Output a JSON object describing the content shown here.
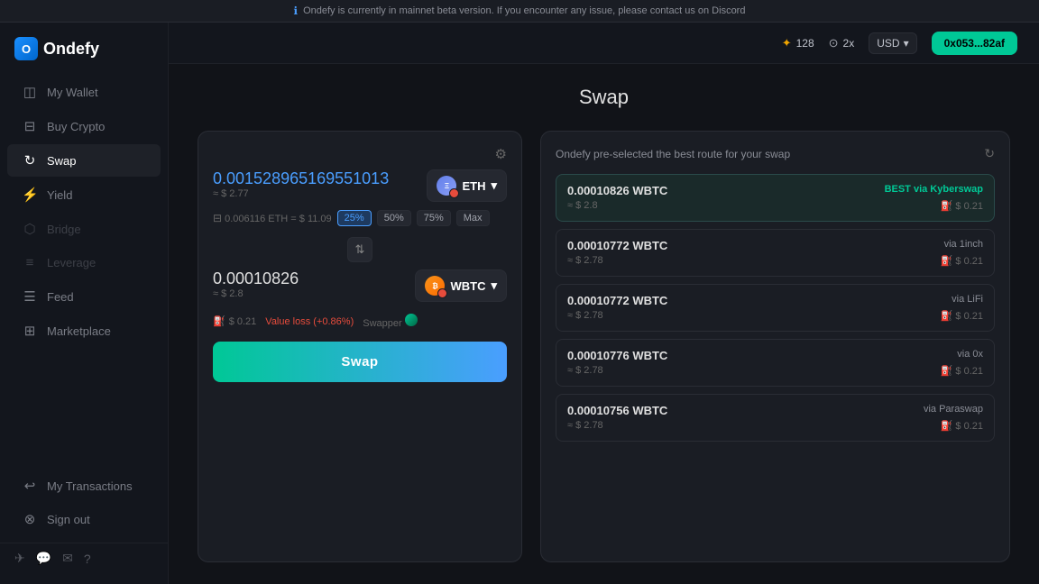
{
  "banner": {
    "icon": "ℹ",
    "text": "Ondefy is currently in mainnet beta version. If you encounter any issue, please contact us on Discord"
  },
  "header": {
    "stars": "128",
    "multiplier": "2x",
    "currency": "USD",
    "wallet_address": "0x053...82af"
  },
  "sidebar": {
    "logo_text": "Ondefy",
    "items": [
      {
        "id": "my-wallet",
        "label": "My Wallet",
        "icon": "◫",
        "active": false,
        "disabled": false
      },
      {
        "id": "buy-crypto",
        "label": "Buy Crypto",
        "icon": "⊟",
        "active": false,
        "disabled": false
      },
      {
        "id": "swap",
        "label": "Swap",
        "icon": "↻",
        "active": true,
        "disabled": false
      },
      {
        "id": "yield",
        "label": "Yield",
        "icon": "⚡",
        "active": false,
        "disabled": false
      },
      {
        "id": "bridge",
        "label": "Bridge",
        "icon": "⬡",
        "active": false,
        "disabled": true
      },
      {
        "id": "leverage",
        "label": "Leverage",
        "icon": "≡",
        "active": false,
        "disabled": true
      },
      {
        "id": "feed",
        "label": "Feed",
        "icon": "☰",
        "active": false,
        "disabled": false
      },
      {
        "id": "marketplace",
        "label": "Marketplace",
        "icon": "⊞",
        "active": false,
        "disabled": false
      },
      {
        "id": "my-transactions",
        "label": "My Transactions",
        "icon": "↩",
        "active": false,
        "disabled": false
      },
      {
        "id": "sign-out",
        "label": "Sign out",
        "icon": "⊗",
        "active": false,
        "disabled": false
      }
    ],
    "footer_icons": [
      "✈",
      "💬",
      "✉",
      "?"
    ]
  },
  "page": {
    "title": "Swap"
  },
  "swap": {
    "input_amount": "0.001528965169551013",
    "input_usd": "≈ $ 2.77",
    "input_token": "ETH",
    "balance_label": "0.006116 ETH = $ 11.09",
    "percent_options": [
      "25%",
      "50%",
      "75%",
      "Max"
    ],
    "active_percent": "25%",
    "output_amount": "0.00010826",
    "output_usd": "≈ $ 2.8",
    "output_token": "WBTC",
    "gas_fee": "$ 0.21",
    "value_loss_label": "Value loss (+0.86%)",
    "swapper_label": "Swapper",
    "swap_button": "Swap"
  },
  "routes": {
    "header": "Ondefy pre-selected the best route for your swap",
    "items": [
      {
        "amount": "0.00010826",
        "token": "WBTC",
        "via_label": "BEST via Kyberswap",
        "usd": "≈ $ 2.8",
        "gas": "$ 0.21",
        "best": true
      },
      {
        "amount": "0.00010772",
        "token": "WBTC",
        "via_label": "via 1inch",
        "usd": "≈ $ 2.78",
        "gas": "$ 0.21",
        "best": false
      },
      {
        "amount": "0.00010772",
        "token": "WBTC",
        "via_label": "via LiFi",
        "usd": "≈ $ 2.78",
        "gas": "$ 0.21",
        "best": false
      },
      {
        "amount": "0.00010776",
        "token": "WBTC",
        "via_label": "via 0x",
        "usd": "≈ $ 2.78",
        "gas": "$ 0.21",
        "best": false
      },
      {
        "amount": "0.00010756",
        "token": "WBTC",
        "via_label": "via Paraswap",
        "usd": "≈ $ 2.78",
        "gas": "$ 0.21",
        "best": false
      }
    ]
  }
}
